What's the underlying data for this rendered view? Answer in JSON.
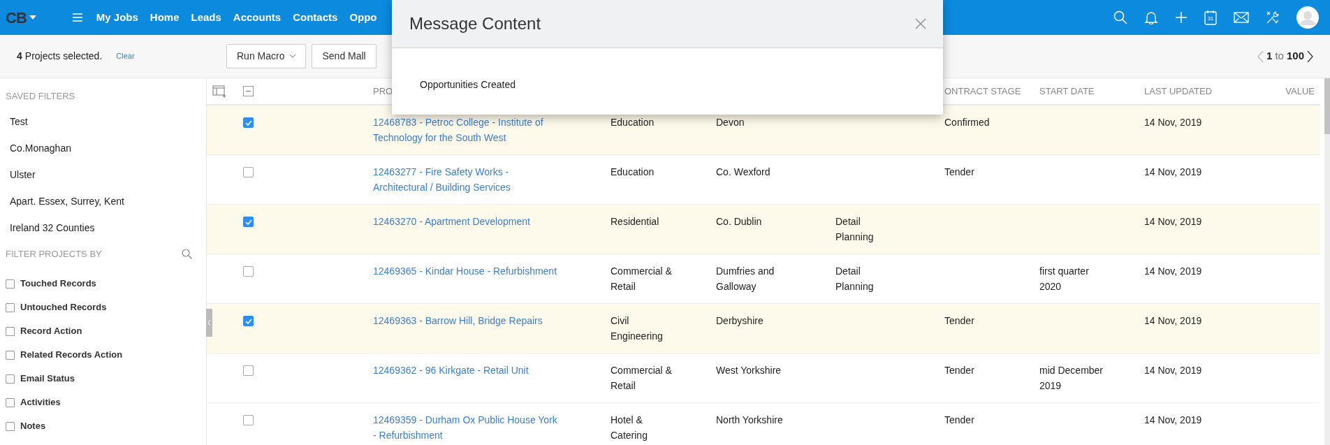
{
  "navbar": {
    "logo": "CB",
    "links": [
      {
        "label": "My Jobs"
      },
      {
        "label": "Home"
      },
      {
        "label": "Leads"
      },
      {
        "label": "Accounts"
      },
      {
        "label": "Contacts"
      },
      {
        "label": "Oppo"
      }
    ],
    "calendar_day": "31"
  },
  "toolbar": {
    "count": "4",
    "selection_text": "Projects selected.",
    "clear": "Clear",
    "buttons": [
      {
        "label": "Run Macro",
        "kind": "dropdown"
      },
      {
        "label": "Send Mall",
        "kind": "plain"
      }
    ],
    "pagination": {
      "from": "1",
      "to_word": "to",
      "to": "100"
    }
  },
  "sidebar": {
    "saved_title": "SAVED FILTERS",
    "saved": [
      "Test",
      "Co.Monaghan",
      "Ulster",
      "Apart. Essex, Surrey, Kent",
      "Ireland 32 Counties"
    ],
    "filter_title": "FILTER PROJECTS BY",
    "filters": [
      {
        "label": "Touched Records",
        "checked": false
      },
      {
        "label": "Untouched Records",
        "checked": false
      },
      {
        "label": "Record Action",
        "checked": false
      },
      {
        "label": "Related Records Action",
        "checked": false
      },
      {
        "label": "Email Status",
        "checked": false
      },
      {
        "label": "Activities",
        "checked": false
      },
      {
        "label": "Notes",
        "checked": false
      }
    ]
  },
  "table": {
    "select_all": {
      "indeterminate": true
    },
    "columns": [
      {
        "label": "PRO"
      },
      {},
      {},
      {},
      {
        "label": "ONTRACT STAGE"
      },
      {
        "label": "START DATE"
      },
      {
        "label": "LAST UPDATED"
      },
      {
        "label": "VALUE"
      }
    ],
    "rows": [
      {
        "selected": true,
        "cells": [
          "12468783 - Petroc College - Institute of Technology for the South West",
          "Education",
          "Devon",
          "",
          "Confirmed",
          "",
          "14 Nov, 2019",
          ""
        ]
      },
      {
        "selected": false,
        "cells": [
          "12463277 - Fire Safety Works - Architectural / Building Services",
          "Education",
          "Co. Wexford",
          "",
          "Tender",
          "",
          "14 Nov, 2019",
          ""
        ]
      },
      {
        "selected": true,
        "cells": [
          "12463270 - Apartment Development",
          "Residential",
          "Co. Dublin",
          "Detail Planning",
          "",
          "",
          "14 Nov, 2019",
          ""
        ]
      },
      {
        "selected": false,
        "cells": [
          "12469365 - Kindar House - Refurbishment",
          "Commercial & Retail",
          "Dumfries and Galloway",
          "Detail Planning",
          "",
          "first quarter 2020",
          "14 Nov, 2019",
          ""
        ]
      },
      {
        "selected": true,
        "cells": [
          "12469363 - Barrow Hill, Bridge Repairs",
          "Civil Engineering",
          "Derbyshire",
          "",
          "Tender",
          "",
          "14 Nov, 2019",
          ""
        ]
      },
      {
        "selected": false,
        "cells": [
          "12469362 - 96 Kirkgate - Retail Unit",
          "Commercial & Retail",
          "West Yorkshire",
          "",
          "Tender",
          "mid December 2019",
          "14 Nov, 2019",
          ""
        ]
      },
      {
        "selected": false,
        "cells": [
          "12469359 - Durham Ox Public House York - Refurbishment",
          "Hotel & Catering",
          "North Yorkshire",
          "",
          "Tender",
          "",
          "14 Nov, 2019",
          ""
        ]
      }
    ]
  },
  "modal": {
    "title": "Message Content",
    "body": "Opportunities Created"
  }
}
